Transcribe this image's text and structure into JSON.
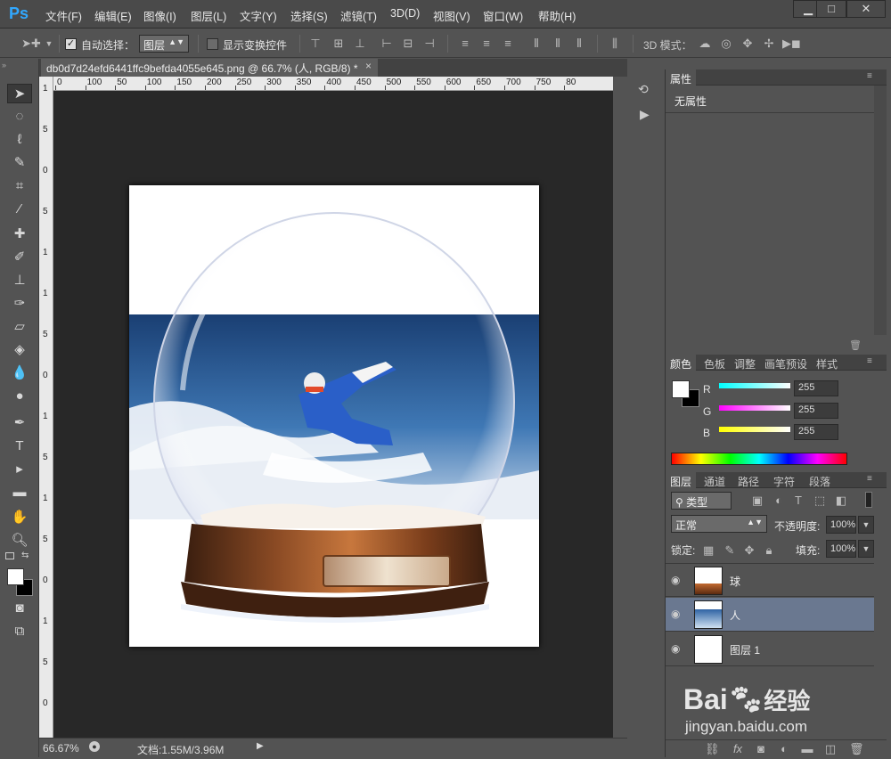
{
  "app": {
    "logo": "Ps"
  },
  "menu": [
    "文件(F)",
    "编辑(E)",
    "图像(I)",
    "图层(L)",
    "文字(Y)",
    "选择(S)",
    "滤镜(T)",
    "3D(D)",
    "视图(V)",
    "窗口(W)",
    "帮助(H)"
  ],
  "window_controls": {
    "minimize": "▁",
    "maximize": "□",
    "close": "✕"
  },
  "options": {
    "auto_select_label": "自动选择：",
    "auto_select_value": "图层",
    "show_transform_label": "显示变换控件",
    "mode3d_label": "3D 模式："
  },
  "document": {
    "tab_title": "db0d7d24efd6441ffc9befda4055e645.png @ 66.7% (人, RGB/8) *",
    "close": "×"
  },
  "ruler": {
    "top": [
      "0",
      "100",
      "50",
      "100",
      "150",
      "200",
      "250",
      "300",
      "350",
      "400",
      "450",
      "500",
      "550",
      "600",
      "650",
      "700",
      "750",
      "80"
    ],
    "left": [
      "1",
      "5",
      "0",
      "5",
      "1",
      "1",
      "5",
      "0",
      "1",
      "5",
      "1",
      "5",
      "0",
      "1",
      "5",
      "0"
    ]
  },
  "status": {
    "zoom": "66.67%",
    "doc": "文档:1.55M/3.96M"
  },
  "properties": {
    "tab": "属性",
    "text": "无属性"
  },
  "color_panel": {
    "tabs": [
      "颜色",
      "色板",
      "调整",
      "画笔预设",
      "样式"
    ],
    "channels": [
      {
        "label": "R",
        "value": "255",
        "color": "#00ffff"
      },
      {
        "label": "G",
        "value": "255",
        "color": "#ff00ff"
      },
      {
        "label": "B",
        "value": "255",
        "color": "#ffff00"
      }
    ]
  },
  "layers_panel": {
    "tabs": [
      "图层",
      "通道",
      "路径",
      "字符",
      "段落"
    ],
    "filter_label": "类型",
    "blend_mode": "正常",
    "opacity_label": "不透明度:",
    "opacity_value": "100%",
    "lock_label": "锁定:",
    "fill_label": "填充:",
    "fill_value": "100%",
    "layers": [
      {
        "name": "球",
        "selected": false
      },
      {
        "name": "人",
        "selected": true
      },
      {
        "name": "图层 1",
        "selected": false
      }
    ]
  },
  "watermark": {
    "brand": "Bai",
    "brand2": "经验",
    "url": "jingyan.baidu.com"
  }
}
